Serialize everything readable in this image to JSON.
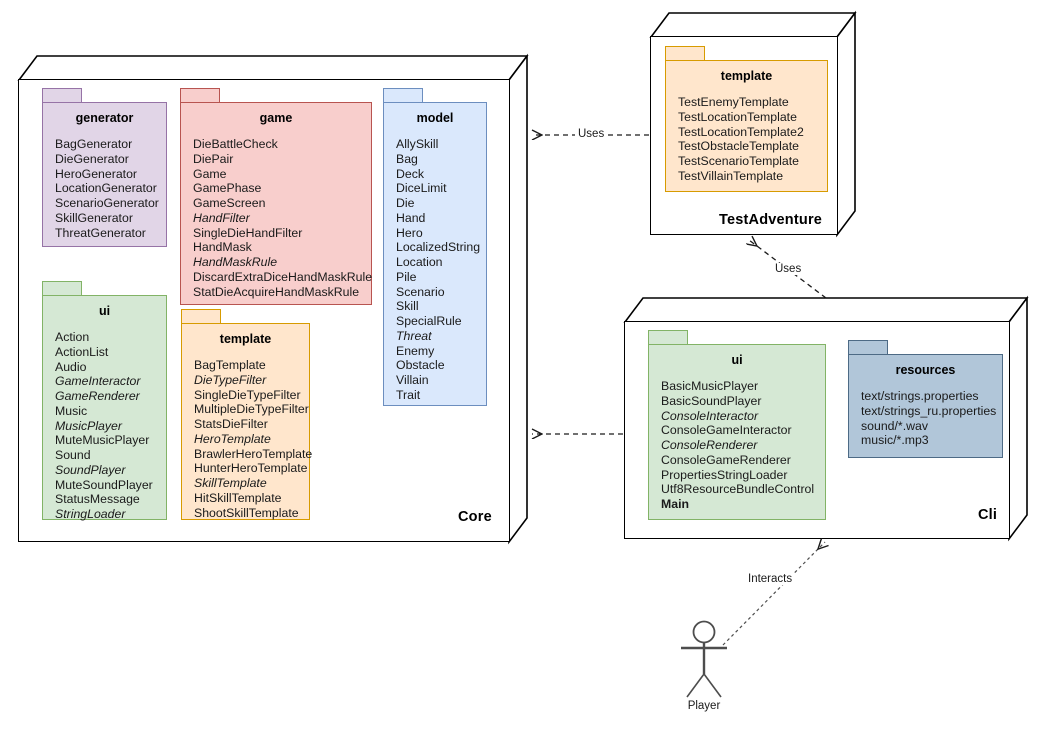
{
  "diagram": {
    "title": "UML Package Diagram",
    "colors": {
      "purple_fill": "#e1d5e7",
      "purple_border": "#9673a6",
      "red_fill": "#f8cecc",
      "red_border": "#b85450",
      "blue_fill": "#dae8fc",
      "blue_border": "#6c8ebf",
      "green_fill": "#d5e8d4",
      "green_border": "#82b366",
      "orange_fill": "#ffe6cc",
      "orange_border": "#d79b00",
      "steel_fill": "#b1c6d9",
      "steel_border": "#4d6a85",
      "outline": "#000000",
      "edge": "#4d4d4d"
    }
  },
  "packages": {
    "core": {
      "name": "Core",
      "children": {
        "generator": {
          "name": "generator",
          "items": [
            {
              "text": "BagGenerator",
              "style": "normal"
            },
            {
              "text": "DieGenerator",
              "style": "normal"
            },
            {
              "text": "HeroGenerator",
              "style": "normal"
            },
            {
              "text": "LocationGenerator",
              "style": "normal"
            },
            {
              "text": "ScenarioGenerator",
              "style": "normal"
            },
            {
              "text": "SkillGenerator",
              "style": "normal"
            },
            {
              "text": "ThreatGenerator",
              "style": "normal"
            }
          ]
        },
        "game": {
          "name": "game",
          "items": [
            {
              "text": "DieBattleCheck",
              "style": "normal"
            },
            {
              "text": "DiePair",
              "style": "normal"
            },
            {
              "text": "Game",
              "style": "normal"
            },
            {
              "text": "GamePhase",
              "style": "normal"
            },
            {
              "text": "GameScreen",
              "style": "normal"
            },
            {
              "text": "HandFilter",
              "style": "italic"
            },
            {
              "text": "SingleDieHandFilter",
              "style": "normal"
            },
            {
              "text": "HandMask",
              "style": "normal"
            },
            {
              "text": "HandMaskRule",
              "style": "italic"
            },
            {
              "text": "DiscardExtraDiceHandMaskRule",
              "style": "normal"
            },
            {
              "text": "StatDieAcquireHandMaskRule",
              "style": "normal"
            }
          ]
        },
        "model": {
          "name": "model",
          "items": [
            {
              "text": "AllySkill",
              "style": "normal"
            },
            {
              "text": "Bag",
              "style": "normal"
            },
            {
              "text": "Deck",
              "style": "normal"
            },
            {
              "text": "DiceLimit",
              "style": "normal"
            },
            {
              "text": "Die",
              "style": "normal"
            },
            {
              "text": "Hand",
              "style": "normal"
            },
            {
              "text": "Hero",
              "style": "normal"
            },
            {
              "text": "LocalizedString",
              "style": "normal"
            },
            {
              "text": "Location",
              "style": "normal"
            },
            {
              "text": "Pile",
              "style": "normal"
            },
            {
              "text": "Scenario",
              "style": "normal"
            },
            {
              "text": "Skill",
              "style": "normal"
            },
            {
              "text": "SpecialRule",
              "style": "normal"
            },
            {
              "text": "Threat",
              "style": "italic"
            },
            {
              "text": "Enemy",
              "style": "normal"
            },
            {
              "text": "Obstacle",
              "style": "normal"
            },
            {
              "text": "Villain",
              "style": "normal"
            },
            {
              "text": "Trait",
              "style": "normal"
            }
          ]
        },
        "ui": {
          "name": "ui",
          "items": [
            {
              "text": "Action",
              "style": "normal"
            },
            {
              "text": "ActionList",
              "style": "normal"
            },
            {
              "text": "Audio",
              "style": "normal"
            },
            {
              "text": "GameInteractor",
              "style": "italic"
            },
            {
              "text": "GameRenderer",
              "style": "italic"
            },
            {
              "text": "Music",
              "style": "normal"
            },
            {
              "text": "MusicPlayer",
              "style": "italic"
            },
            {
              "text": "MuteMusicPlayer",
              "style": "normal"
            },
            {
              "text": "Sound",
              "style": "normal"
            },
            {
              "text": "SoundPlayer",
              "style": "italic"
            },
            {
              "text": "MuteSoundPlayer",
              "style": "normal"
            },
            {
              "text": "StatusMessage",
              "style": "normal"
            },
            {
              "text": "StringLoader",
              "style": "italic"
            }
          ]
        },
        "template": {
          "name": "template",
          "items": [
            {
              "text": "BagTemplate",
              "style": "normal"
            },
            {
              "text": "DieTypeFilter",
              "style": "italic"
            },
            {
              "text": "SingleDieTypeFilter",
              "style": "normal"
            },
            {
              "text": "MultipleDieTypeFilter",
              "style": "normal"
            },
            {
              "text": "StatsDieFilter",
              "style": "normal"
            },
            {
              "text": "HeroTemplate",
              "style": "italic"
            },
            {
              "text": "BrawlerHeroTemplate",
              "style": "normal"
            },
            {
              "text": "HunterHeroTemplate",
              "style": "normal"
            },
            {
              "text": "SkillTemplate",
              "style": "italic"
            },
            {
              "text": "HitSkillTemplate",
              "style": "normal"
            },
            {
              "text": "ShootSkillTemplate",
              "style": "normal"
            }
          ]
        }
      }
    },
    "test_adventure": {
      "name": "TestAdventure",
      "children": {
        "template": {
          "name": "template",
          "items": [
            {
              "text": "TestEnemyTemplate",
              "style": "normal"
            },
            {
              "text": "TestLocationTemplate",
              "style": "normal"
            },
            {
              "text": "TestLocationTemplate2",
              "style": "normal"
            },
            {
              "text": "TestObstacleTemplate",
              "style": "normal"
            },
            {
              "text": "TestScenarioTemplate",
              "style": "normal"
            },
            {
              "text": "TestVillainTemplate",
              "style": "normal"
            }
          ]
        }
      }
    },
    "cli": {
      "name": "Cli",
      "children": {
        "ui": {
          "name": "ui",
          "items": [
            {
              "text": "BasicMusicPlayer",
              "style": "normal"
            },
            {
              "text": "BasicSoundPlayer",
              "style": "normal"
            },
            {
              "text": "ConsoleInteractor",
              "style": "italic"
            },
            {
              "text": "ConsoleGameInteractor",
              "style": "normal"
            },
            {
              "text": "ConsoleRenderer",
              "style": "italic"
            },
            {
              "text": "ConsoleGameRenderer",
              "style": "normal"
            },
            {
              "text": "PropertiesStringLoader",
              "style": "normal"
            },
            {
              "text": "Utf8ResourceBundleControl",
              "style": "normal"
            },
            {
              "text": "Main",
              "style": "bold"
            }
          ]
        },
        "resources": {
          "name": "resources",
          "items": [
            {
              "text": "text/strings.properties",
              "style": "normal"
            },
            {
              "text": "text/strings_ru.properties",
              "style": "normal"
            },
            {
              "text": "sound/*.wav",
              "style": "normal"
            },
            {
              "text": "music/*.mp3",
              "style": "normal"
            }
          ]
        }
      }
    }
  },
  "edges": [
    {
      "id": "testadventure-uses-core",
      "label": "Uses",
      "from": "test_adventure",
      "to": "core"
    },
    {
      "id": "cli-uses-testadventure",
      "label": "Uses",
      "from": "cli",
      "to": "test_adventure"
    },
    {
      "id": "cli-to-core",
      "label": "",
      "from": "cli",
      "to": "core"
    },
    {
      "id": "player-interacts-cli",
      "label": "Interacts",
      "from": "player",
      "to": "cli"
    }
  ],
  "actor": {
    "name": "Player"
  }
}
